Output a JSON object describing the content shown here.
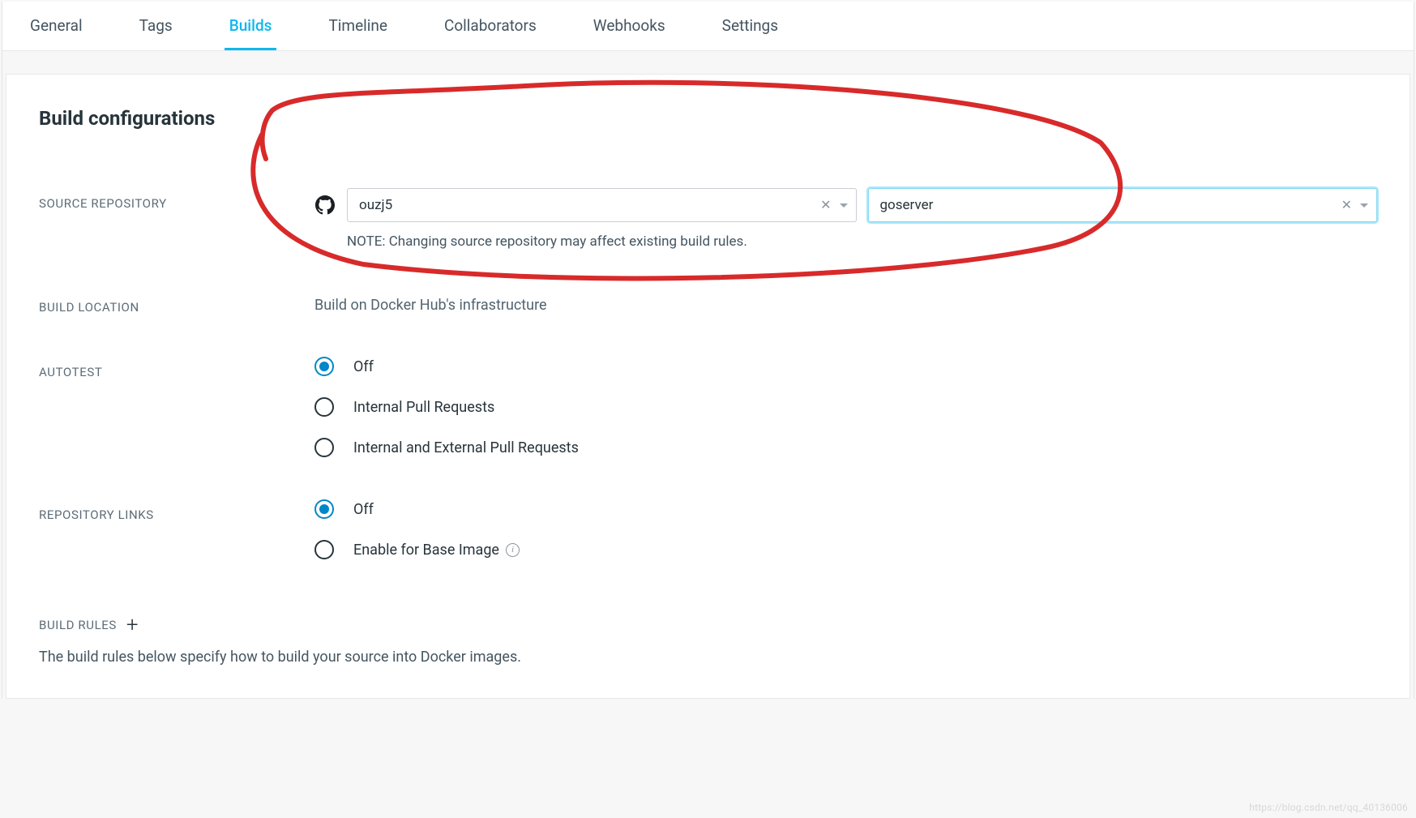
{
  "tabs": [
    {
      "label": "General"
    },
    {
      "label": "Tags"
    },
    {
      "label": "Builds",
      "active": true
    },
    {
      "label": "Timeline"
    },
    {
      "label": "Collaborators"
    },
    {
      "label": "Webhooks"
    },
    {
      "label": "Settings"
    }
  ],
  "page_title": "Build configurations",
  "sections": {
    "source_repository": {
      "label": "SOURCE REPOSITORY",
      "owner_value": "ouzj5",
      "repo_value": "goserver",
      "note": "NOTE: Changing source repository may affect existing build rules."
    },
    "build_location": {
      "label": "BUILD LOCATION",
      "text": "Build on Docker Hub's infrastructure"
    },
    "autotest": {
      "label": "AUTOTEST",
      "options": [
        {
          "label": "Off",
          "selected": true
        },
        {
          "label": "Internal Pull Requests",
          "selected": false
        },
        {
          "label": "Internal and External Pull Requests",
          "selected": false
        }
      ]
    },
    "repository_links": {
      "label": "REPOSITORY LINKS",
      "options": [
        {
          "label": "Off",
          "selected": true
        },
        {
          "label": "Enable for Base Image",
          "selected": false,
          "info": true
        }
      ]
    },
    "build_rules": {
      "label": "BUILD RULES",
      "description": "The build rules below specify how to build your source into Docker images."
    }
  },
  "watermark": "https://blog.csdn.net/qq_40136006"
}
